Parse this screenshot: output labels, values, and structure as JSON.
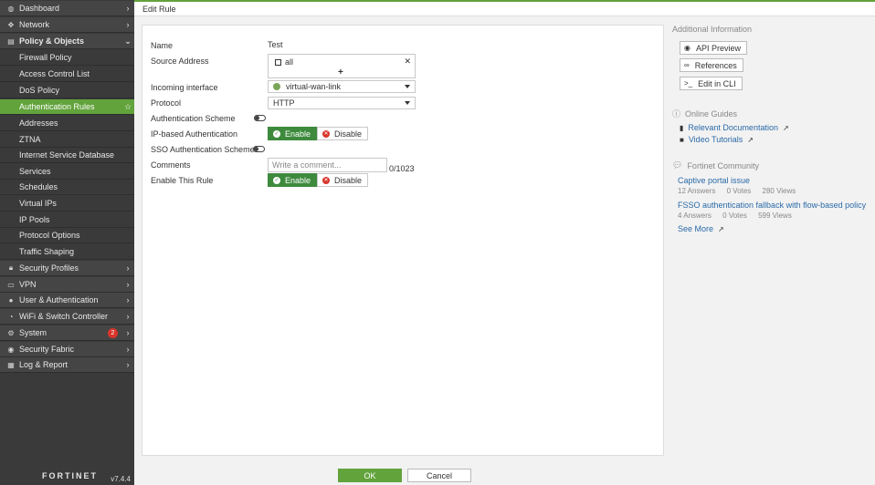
{
  "window": {
    "title": "Edit Rule"
  },
  "sidebar": {
    "items": [
      {
        "label": "Dashboard",
        "icon": "dashboard-icon"
      },
      {
        "label": "Network",
        "icon": "network-icon"
      },
      {
        "label": "Policy & Objects",
        "icon": "policy-icon"
      },
      {
        "label": "Firewall Policy"
      },
      {
        "label": "Access Control List"
      },
      {
        "label": "DoS Policy"
      },
      {
        "label": "Authentication Rules"
      },
      {
        "label": "Addresses"
      },
      {
        "label": "ZTNA"
      },
      {
        "label": "Internet Service Database"
      },
      {
        "label": "Services"
      },
      {
        "label": "Schedules"
      },
      {
        "label": "Virtual IPs"
      },
      {
        "label": "IP Pools"
      },
      {
        "label": "Protocol Options"
      },
      {
        "label": "Traffic Shaping"
      },
      {
        "label": "Security Profiles",
        "icon": "lock-icon"
      },
      {
        "label": "VPN",
        "icon": "monitor-icon"
      },
      {
        "label": "User & Authentication",
        "icon": "user-icon"
      },
      {
        "label": "WiFi & Switch Controller",
        "icon": "wifi-icon"
      },
      {
        "label": "System",
        "icon": "gear-icon",
        "badge": "2"
      },
      {
        "label": "Security Fabric",
        "icon": "fabric-icon"
      },
      {
        "label": "Log & Report",
        "icon": "chart-icon"
      }
    ],
    "logo": "FORTINET",
    "version": "v7.4.4"
  },
  "form": {
    "name_label": "Name",
    "name_value": "Test",
    "source_label": "Source Address",
    "source_value": "all",
    "incoming_label": "Incoming interface",
    "incoming_value": "virtual-wan-link",
    "protocol_label": "Protocol",
    "protocol_value": "HTTP",
    "auth_scheme_label": "Authentication Scheme",
    "ip_auth_label": "IP-based Authentication",
    "sso_label": "SSO Authentication Scheme",
    "comments_label": "Comments",
    "comments_placeholder": "Write a comment...",
    "comments_counter": "0/1023",
    "enable_rule_label": "Enable This Rule",
    "enable_label": "Enable",
    "disable_label": "Disable"
  },
  "info": {
    "additional_title": "Additional Information",
    "api_preview": "API Preview",
    "references": "References",
    "edit_cli": "Edit in CLI",
    "guides_title": "Online Guides",
    "relevant_docs": "Relevant Documentation",
    "video_tutorials": "Video Tutorials",
    "community_title": "Fortinet Community",
    "posts": [
      {
        "title": "Captive portal issue",
        "answers": "12 Answers",
        "votes": "0 Votes",
        "views": "280 Views"
      },
      {
        "title": "FSSO authentication fallback with flow-based policy",
        "answers": "4 Answers",
        "votes": "0 Votes",
        "views": "599 Views"
      }
    ],
    "see_more": "See More"
  },
  "footer": {
    "ok": "OK",
    "cancel": "Cancel"
  }
}
